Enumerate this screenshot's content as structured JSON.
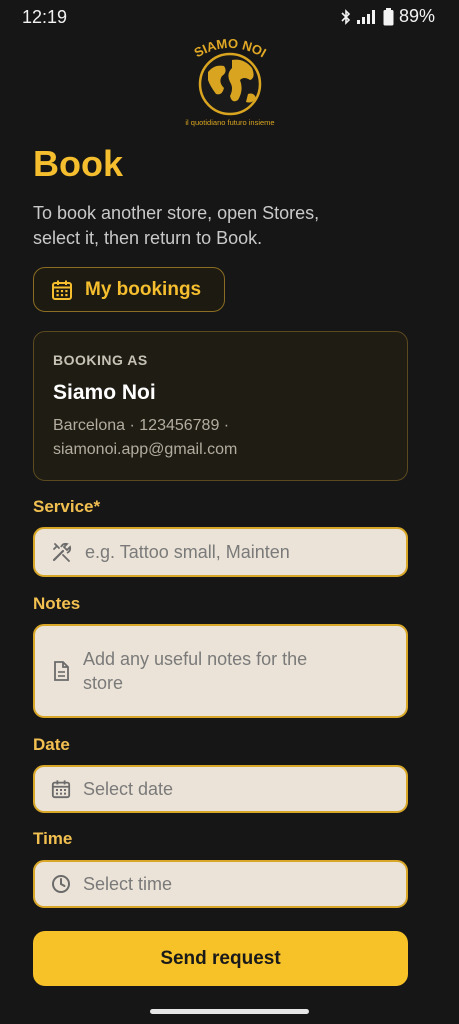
{
  "status_bar": {
    "time": "12:19",
    "battery": "89%",
    "network": "4G"
  },
  "logo": {
    "brand_text": "SIAMO NOI",
    "tagline": "il quotidiano futuro insieme"
  },
  "page": {
    "title": "Book",
    "subtitle": "To book another store, open Stores, select it, then return to Book."
  },
  "my_bookings_button": {
    "label": "My bookings",
    "icon": "calendar-icon"
  },
  "booking_card": {
    "heading": "BOOKING AS",
    "name": "Siamo Noi",
    "details_line1": "Barcelona · 123456789 ·",
    "details_line2": "siamonoi.app@gmail.com"
  },
  "form": {
    "service": {
      "label": "Service*",
      "placeholder": "e.g. Tattoo small, Mainten",
      "icon": "tools-icon"
    },
    "notes": {
      "label": "Notes",
      "placeholder": "Add any useful notes for the store",
      "icon": "document-icon"
    },
    "date": {
      "label": "Date",
      "placeholder": "Select date",
      "icon": "calendar-icon"
    },
    "time": {
      "label": "Time",
      "placeholder": "Select time",
      "icon": "clock-icon"
    }
  },
  "submit": {
    "label": "Send request"
  },
  "colors": {
    "accent": "#f5be2e",
    "background": "#161616",
    "input_bg": "#ebe3d7",
    "button": "#f7c228"
  }
}
